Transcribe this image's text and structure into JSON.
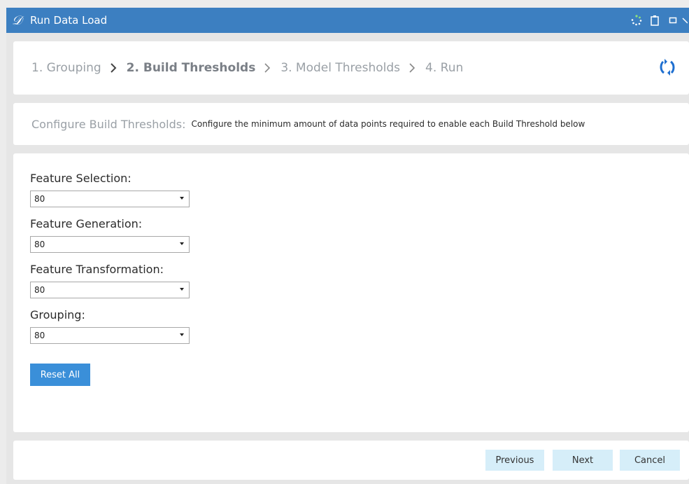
{
  "window": {
    "logo_glyph": "𝒟",
    "title": "Run Data Load",
    "icons": [
      "spinner-icon",
      "clipboard-icon",
      "maximize-icon",
      "close-icon"
    ]
  },
  "wizard": {
    "steps": [
      {
        "label": "1. Grouping",
        "active": false
      },
      {
        "label": "2. Build Thresholds",
        "active": true
      },
      {
        "label": "3. Model Thresholds",
        "active": false
      },
      {
        "label": "4. Run",
        "active": false
      }
    ]
  },
  "config": {
    "heading": "Configure Build Thresholds:",
    "description": "Configure the minimum amount of data points required to enable each Build Threshold below"
  },
  "fields": [
    {
      "label": "Feature Selection:",
      "value": "80"
    },
    {
      "label": "Feature Generation:",
      "value": "80"
    },
    {
      "label": "Feature Transformation:",
      "value": "80"
    },
    {
      "label": "Grouping:",
      "value": "80"
    }
  ],
  "actions": {
    "reset_all": "Reset All",
    "previous": "Previous",
    "next": "Next",
    "cancel": "Cancel"
  },
  "colors": {
    "titlebar": "#3c7fc1",
    "primary_button": "#3a8fd9",
    "secondary_button": "#d6eef9",
    "refresh_icon": "#1e6fd0"
  }
}
